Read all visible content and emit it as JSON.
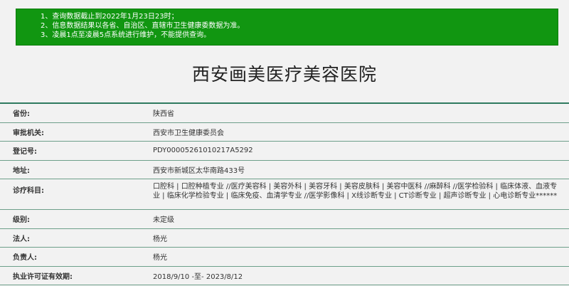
{
  "notice": {
    "lines": [
      "1、查询数据截止到2022年1月23日23时；",
      "2、信息数据结果以各省、自治区、直辖市卫生健康委数据为准。",
      "3、凌晨1点至凌晨5点系统进行维护，不能提供查询。"
    ]
  },
  "hospital": {
    "name": "西安画美医疗美容医院"
  },
  "info": {
    "rows": [
      {
        "label": "省份:",
        "value": "陕西省"
      },
      {
        "label": "审批机关:",
        "value": "西安市卫生健康委员会"
      },
      {
        "label": "登记号:",
        "value": "PDY00005261010217A5292"
      },
      {
        "label": "地址:",
        "value": "西安市新城区太华南路433号"
      },
      {
        "label": "诊疗科目:",
        "value": "口腔科 | 口腔种植专业 //医疗美容科 | 美容外科 | 美容牙科 | 美容皮肤科 | 美容中医科 //麻醉科 //医学检验科 | 临床体液、血液专业 | 临床化学检验专业 | 临床免疫、血清学专业 //医学影像科 | X线诊断专业 | CT诊断专业 | 超声诊断专业 | 心电诊断专业******"
      },
      {
        "label": "级别:",
        "value": "未定级"
      },
      {
        "label": "法人:",
        "value": "杨光"
      },
      {
        "label": "负责人:",
        "value": "杨光"
      },
      {
        "label": "执业许可证有效期:",
        "value": "2018/9/10 -至- 2023/8/12"
      }
    ]
  }
}
